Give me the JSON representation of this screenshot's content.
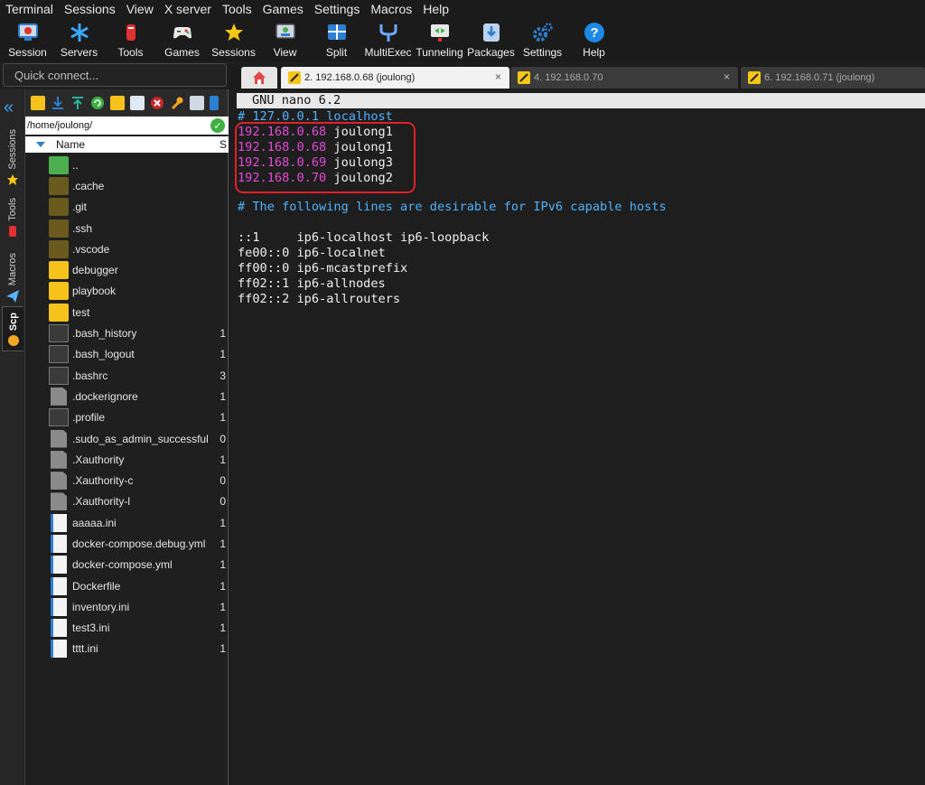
{
  "menu": [
    "Terminal",
    "Sessions",
    "View",
    "X server",
    "Tools",
    "Games",
    "Settings",
    "Macros",
    "Help"
  ],
  "toolbar": [
    {
      "label": "Session",
      "icon": "session-icon",
      "color": "#2d7fd3"
    },
    {
      "label": "Servers",
      "icon": "servers-icon",
      "color": "#39a9ff"
    },
    {
      "label": "Tools",
      "icon": "tools-icon",
      "color": "#e03030"
    },
    {
      "label": "Games",
      "icon": "games-icon",
      "color": "#e8e8e8"
    },
    {
      "label": "Sessions",
      "icon": "star-icon",
      "color": "#f5c518"
    },
    {
      "label": "View",
      "icon": "view-icon",
      "color": "#4caf50"
    },
    {
      "label": "Split",
      "icon": "split-icon",
      "color": "#2d7fd3"
    },
    {
      "label": "MultiExec",
      "icon": "multiexec-icon",
      "color": "#6fa8ff"
    },
    {
      "label": "Tunneling",
      "icon": "tunneling-icon",
      "color": "#4caf50"
    },
    {
      "label": "Packages",
      "icon": "packages-icon",
      "color": "#2d7fd3"
    },
    {
      "label": "Settings",
      "icon": "settings-icon",
      "color": "#2d7fd3"
    },
    {
      "label": "Help",
      "icon": "help-icon",
      "color": "#1e88e5"
    }
  ],
  "quick_connect": {
    "placeholder": "Quick connect..."
  },
  "tabs": [
    {
      "label": "2. 192.168.0.68 (joulong)",
      "active": true,
      "close": "×"
    },
    {
      "label": "4. 192.168.0.70",
      "active": false,
      "close": "×"
    },
    {
      "label": "6. 192.168.0.71 (joulong)",
      "active": false
    }
  ],
  "side_tabs": [
    "Sessions",
    "Tools",
    "Macros",
    "Scp"
  ],
  "sftp": {
    "path": "/home/joulong/",
    "col_name": "Name",
    "col_size": "S",
    "files": [
      {
        "name": "..",
        "size": "",
        "type": "up"
      },
      {
        "name": ".cache",
        "size": "",
        "type": "folder-dark"
      },
      {
        "name": ".git",
        "size": "",
        "type": "folder-dark"
      },
      {
        "name": ".ssh",
        "size": "",
        "type": "folder-dark"
      },
      {
        "name": ".vscode",
        "size": "",
        "type": "folder-dark"
      },
      {
        "name": "debugger",
        "size": "",
        "type": "folder"
      },
      {
        "name": "playbook",
        "size": "",
        "type": "folder"
      },
      {
        "name": "test",
        "size": "",
        "type": "folder"
      },
      {
        "name": ".bash_history",
        "size": "1",
        "type": "term"
      },
      {
        "name": ".bash_logout",
        "size": "1",
        "type": "term"
      },
      {
        "name": ".bashrc",
        "size": "3",
        "type": "term"
      },
      {
        "name": ".dockerignore",
        "size": "1",
        "type": "doc"
      },
      {
        "name": ".profile",
        "size": "1",
        "type": "term"
      },
      {
        "name": ".sudo_as_admin_successful",
        "size": "0",
        "type": "doc"
      },
      {
        "name": ".Xauthority",
        "size": "1",
        "type": "doc"
      },
      {
        "name": ".Xauthority-c",
        "size": "0",
        "type": "doc"
      },
      {
        "name": ".Xauthority-l",
        "size": "0",
        "type": "doc"
      },
      {
        "name": "aaaaa.ini",
        "size": "1",
        "type": "ini"
      },
      {
        "name": "docker-compose.debug.yml",
        "size": "1",
        "type": "ini"
      },
      {
        "name": "docker-compose.yml",
        "size": "1",
        "type": "ini"
      },
      {
        "name": "Dockerfile",
        "size": "1",
        "type": "ini"
      },
      {
        "name": "inventory.ini",
        "size": "1",
        "type": "ini"
      },
      {
        "name": "test3.ini",
        "size": "1",
        "type": "ini"
      },
      {
        "name": "tttt.ini",
        "size": "1",
        "type": "ini"
      }
    ]
  },
  "terminal": {
    "header": "GNU nano 6.2",
    "line_localhost": "# 127.0.0.1 localhost",
    "hosts": [
      {
        "ip": "192.168.0.68",
        "name": "joulong1"
      },
      {
        "ip": "192.168.0.68",
        "name": "joulong1"
      },
      {
        "ip": "192.168.0.69",
        "name": "joulong3"
      },
      {
        "ip": "192.168.0.70",
        "name": "joulong2"
      }
    ],
    "comment_ipv6": "# The following lines are desirable for IPv6 capable hosts",
    "ipv6_lines": [
      "::1     ip6-localhost ip6-loopback",
      "fe00::0 ip6-localnet",
      "ff00::0 ip6-mcastprefix",
      "ff02::1 ip6-allnodes",
      "ff02::2 ip6-allrouters"
    ]
  }
}
